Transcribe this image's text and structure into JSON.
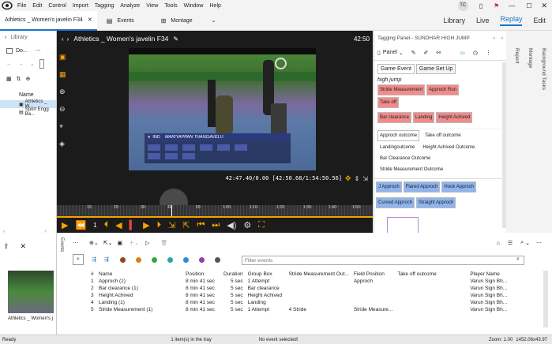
{
  "menu": [
    "File",
    "Edit",
    "Control",
    "Import",
    "Tagging",
    "Analyze",
    "View",
    "Tools",
    "Window",
    "Help"
  ],
  "user_initials": "TC",
  "doc_tab": "Athletics _ Women's javelin F34",
  "toolbar": {
    "events": "Events",
    "montage": "Montage"
  },
  "modes": [
    "Library",
    "Live",
    "Replay",
    "Edit"
  ],
  "active_mode": "Replay",
  "library": {
    "title": "Library",
    "folder": "Do...",
    "col_name": "Name",
    "items": [
      "Athletics _ W...",
      "Sport Engg Ba..."
    ]
  },
  "video": {
    "title": "Athletics _ Women's javelin F34",
    "time_right": "42:50",
    "scoreboard_name": "MARIYAPPAN THANGAVELU",
    "scoreboard_country": "IND",
    "timecode": "42:47.40/0.00 [42:50.68/1:54:50.56]",
    "ticks": [
      "10:",
      "20:",
      "30:",
      "40:",
      "50:",
      "1:00:",
      "1:10:",
      "1:20:",
      "1:30:",
      "1:40:",
      "1:50:"
    ],
    "speed": "1"
  },
  "tagging": {
    "header": "Tagging Panel - SUNDHAR HIGH JUMP",
    "panel_label": "Panel",
    "tabs": [
      "Game Event",
      "Game Set Up"
    ],
    "group_label": "high jump",
    "red_buttons": [
      "Stride Measurement",
      "Approch Run",
      "Take off",
      "Bar clearance",
      "Landing",
      "Height Achived"
    ],
    "outcome_tabs": [
      "Approch outcome",
      "Take off outcome"
    ],
    "outcomes": [
      "Landingoutcome",
      "Height Achived Outcome",
      "Bar Clearance Outcome",
      "Stride Measurement Outcome"
    ],
    "blue_buttons": [
      "J Approch",
      "Flared Approch",
      "Hook Approch",
      "Curved Approch",
      "Straight Approch"
    ]
  },
  "right_strip": [
    "Report",
    "Montage",
    "Background Tasks"
  ],
  "bottom_left": {
    "thumb_label": "Athletics _ Women's j"
  },
  "events": {
    "side_label": "Events",
    "filter_placeholder": "Filter events",
    "columns": [
      "#",
      "Name",
      "Position",
      "Duration",
      "Group Box",
      "Stride Measurement Out...",
      "Field Position",
      "Take off outcome",
      "Player Name"
    ],
    "rows": [
      [
        "1",
        "Approch (1)",
        "8 min 41 sec",
        "5 sec",
        "1 Attempt",
        "",
        "Approch",
        "",
        "Varun Sign Bh..."
      ],
      [
        "2",
        "Bar clearance (1)",
        "8 min 41 sec",
        "5 sec",
        "Bar clearance",
        "",
        "",
        "",
        "Varun Sign Bh..."
      ],
      [
        "3",
        "Height Achived",
        "8 min 41 sec",
        "5 sec",
        "Height Achived",
        "",
        "",
        "",
        "Varun Sign Bh..."
      ],
      [
        "4",
        "Landing (1)",
        "8 min 41 sec",
        "5 sec",
        "Landing",
        "",
        "",
        "",
        "Varun Sign Bh..."
      ],
      [
        "5",
        "Stride Measurement (1)",
        "8 min 41 sec",
        "5 sec",
        "1 Attempt",
        "4 Stride",
        "Stride Measure...",
        "",
        "Varun Sign Bh..."
      ]
    ],
    "dot_colors": [
      "#8b4a1f",
      "#e07b1c",
      "#3aa63a",
      "#2aa6a6",
      "#2b8bd6",
      "#8e44ad",
      "#555555"
    ]
  },
  "status": {
    "left": "Ready",
    "tray": "1 item(s) in the tray",
    "selection": "No event selected!",
    "zoom": "Zoom: 1.00",
    "resolution": "1452.06x43.97"
  },
  "colors": {
    "accent": "#1a73c8",
    "orange": "#f5a300"
  }
}
